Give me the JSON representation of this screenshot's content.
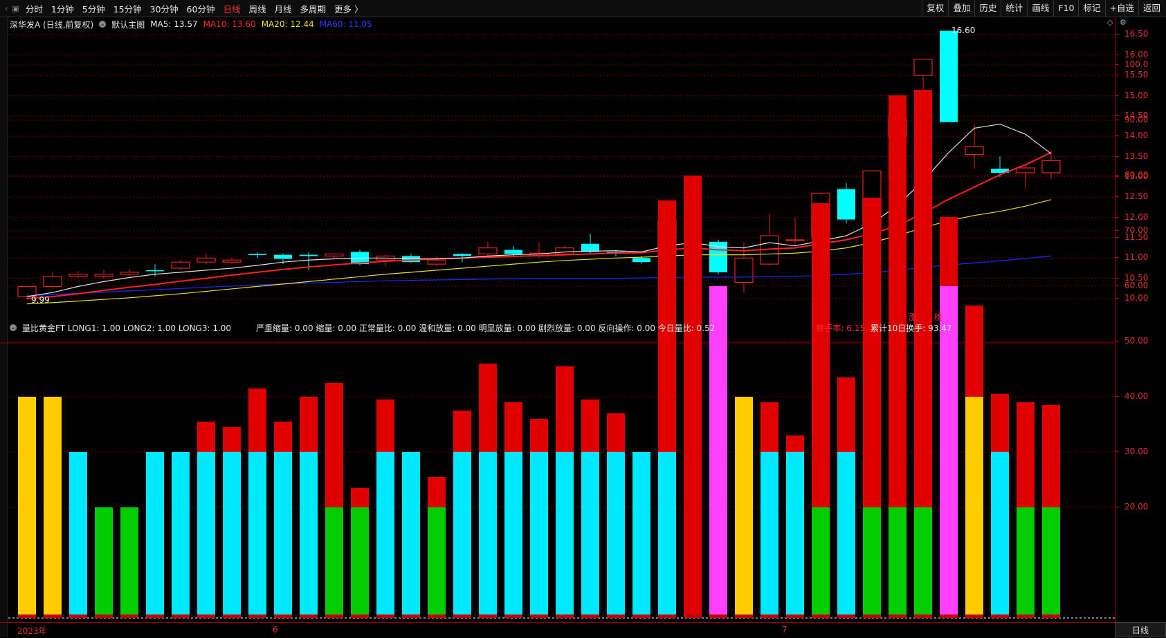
{
  "toolbar": {
    "periods": [
      "分时",
      "1分钟",
      "5分钟",
      "15分钟",
      "30分钟",
      "60分钟",
      "日线",
      "周线",
      "月线",
      "多周期",
      "更多 〉"
    ],
    "active_period": "日线",
    "right_buttons": [
      "复权",
      "叠加",
      "历史",
      "统计",
      "画线",
      "F10",
      "标记",
      "+自选",
      "返回"
    ]
  },
  "legend_main": {
    "stock": "深华发A (日线,前复权)",
    "template": "默认主图",
    "ma5": "MA5: 13.57",
    "ma10": "MA10: 13.60",
    "ma20": "MA20: 12.44",
    "ma60": "MA60: 11.05"
  },
  "legend_sub": {
    "indicator": "量比黄金FT  LONG1: 1.00  LONG2: 1.00  LONG3: 1.00",
    "params": "严重缩量: 0.00  缩量: 0.00  正常量比: 0.00  温和放量: 0.00  明显放量: 0.00  剧烈放量: 0.00  反向操作: 0.00  今日量比: 0.52",
    "turnover": "换手率: 6.15",
    "cum_turnover": "累计10日换手: 93.47"
  },
  "price_axis": [
    "16.50",
    "16.00",
    "15.50",
    "15.00",
    "14.50",
    "14.00",
    "13.50",
    "13.00",
    "12.50",
    "12.00",
    "11.50",
    "11.00",
    "10.50",
    "10.00"
  ],
  "vol_axis": [
    "100.0",
    "90.00",
    "80.00",
    "70.00",
    "60.00",
    "50.00",
    "40.00",
    "30.00",
    "20.00"
  ],
  "annotations": {
    "high": "16.60",
    "low": "9.99",
    "tag_zhang": "涨",
    "tag_bang": "榜"
  },
  "x_labels": [
    "2023年",
    "6",
    "7"
  ],
  "bottom_tab": "日线",
  "colors": {
    "up": "#e8221e",
    "down": "#00ffff",
    "ma5": "#e0e0e0",
    "ma10": "#ff2020",
    "ma20": "#e8e020",
    "ma60": "#1a2aff",
    "axis": "#e03030",
    "grid": "#7a0000"
  },
  "chart_data": [
    {
      "type": "candlestick",
      "title": "深华发A (日线,前复权)",
      "ylim": [
        9.8,
        16.8
      ],
      "candles": [
        {
          "o": 10.05,
          "c": 10.3,
          "h": 10.3,
          "l": 9.99
        },
        {
          "o": 10.3,
          "c": 10.55,
          "h": 10.65,
          "l": 10.25
        },
        {
          "o": 10.55,
          "c": 10.6,
          "h": 10.68,
          "l": 10.5
        },
        {
          "o": 10.55,
          "c": 10.6,
          "h": 10.7,
          "l": 10.5
        },
        {
          "o": 10.6,
          "c": 10.65,
          "h": 10.73,
          "l": 10.55
        },
        {
          "o": 10.7,
          "c": 10.68,
          "h": 10.85,
          "l": 10.55
        },
        {
          "o": 10.75,
          "c": 10.9,
          "h": 10.95,
          "l": 10.7
        },
        {
          "o": 10.9,
          "c": 11.0,
          "h": 11.1,
          "l": 10.85
        },
        {
          "o": 10.9,
          "c": 10.95,
          "h": 11.0,
          "l": 10.85
        },
        {
          "o": 11.1,
          "c": 11.08,
          "h": 11.15,
          "l": 11.0
        },
        {
          "o": 11.08,
          "c": 10.98,
          "h": 11.12,
          "l": 10.85
        },
        {
          "o": 11.08,
          "c": 11.05,
          "h": 11.15,
          "l": 10.7
        },
        {
          "o": 11.05,
          "c": 11.1,
          "h": 11.12,
          "l": 11.0
        },
        {
          "o": 11.15,
          "c": 10.85,
          "h": 11.2,
          "l": 10.82
        },
        {
          "o": 10.95,
          "c": 11.05,
          "h": 11.08,
          "l": 10.8
        },
        {
          "o": 11.05,
          "c": 10.9,
          "h": 11.1,
          "l": 10.88
        },
        {
          "o": 10.85,
          "c": 10.95,
          "h": 11.05,
          "l": 10.8
        },
        {
          "o": 11.1,
          "c": 11.05,
          "h": 11.12,
          "l": 10.9
        },
        {
          "o": 11.1,
          "c": 11.25,
          "h": 11.4,
          "l": 11.05
        },
        {
          "o": 11.2,
          "c": 11.1,
          "h": 11.3,
          "l": 11.05
        },
        {
          "o": 11.05,
          "c": 11.12,
          "h": 11.38,
          "l": 11.0
        },
        {
          "o": 11.1,
          "c": 11.25,
          "h": 11.3,
          "l": 11.05
        },
        {
          "o": 11.35,
          "c": 11.15,
          "h": 11.6,
          "l": 11.1
        },
        {
          "o": 11.15,
          "c": 11.12,
          "h": 11.18,
          "l": 11.05
        },
        {
          "o": 11.0,
          "c": 10.9,
          "h": 11.05,
          "l": 10.85
        },
        {
          "o": 11.05,
          "c": 11.95,
          "h": 11.95,
          "l": 11.0
        },
        {
          "o": 12.2,
          "c": 11.75,
          "h": 12.45,
          "l": 11.35
        },
        {
          "o": 11.4,
          "c": 10.65,
          "h": 11.45,
          "l": 10.6
        },
        {
          "o": 10.4,
          "c": 11.0,
          "h": 11.4,
          "l": 10.15
        },
        {
          "o": 10.85,
          "c": 11.55,
          "h": 12.1,
          "l": 10.82
        },
        {
          "o": 11.45,
          "c": 11.45,
          "h": 12.0,
          "l": 11.35
        },
        {
          "o": 11.5,
          "c": 12.6,
          "h": 12.6,
          "l": 11.45
        },
        {
          "o": 12.7,
          "c": 11.95,
          "h": 12.85,
          "l": 11.85
        },
        {
          "o": 11.75,
          "c": 13.15,
          "h": 13.15,
          "l": 11.75
        },
        {
          "o": 14.0,
          "c": 14.45,
          "h": 14.45,
          "l": 13.6
        },
        {
          "o": 15.5,
          "c": 15.9,
          "h": 15.9,
          "l": 14.95
        },
        {
          "o": 16.6,
          "c": 14.35,
          "h": 16.6,
          "l": 14.35
        },
        {
          "o": 13.55,
          "c": 13.75,
          "h": 14.3,
          "l": 13.2
        },
        {
          "o": 13.2,
          "c": 13.1,
          "h": 13.5,
          "l": 13.0
        },
        {
          "o": 13.1,
          "c": 13.22,
          "h": 13.3,
          "l": 12.7
        },
        {
          "o": 13.1,
          "c": 13.4,
          "h": 13.65,
          "l": 12.95
        }
      ],
      "ma5": [
        10.05,
        10.15,
        10.3,
        10.42,
        10.52,
        10.6,
        10.65,
        10.7,
        10.75,
        10.82,
        10.9,
        10.95,
        10.98,
        11.0,
        11.0,
        10.98,
        10.98,
        11.0,
        11.05,
        11.08,
        11.1,
        11.15,
        11.17,
        11.18,
        11.15,
        11.3,
        11.38,
        11.28,
        11.25,
        11.38,
        11.3,
        11.42,
        11.55,
        11.85,
        12.3,
        12.9,
        13.6,
        14.2,
        14.3,
        14.05,
        13.57
      ],
      "ma10": [
        10.0,
        10.05,
        10.12,
        10.2,
        10.28,
        10.35,
        10.43,
        10.5,
        10.58,
        10.65,
        10.72,
        10.78,
        10.83,
        10.88,
        10.92,
        10.95,
        10.98,
        11.0,
        11.02,
        11.04,
        11.06,
        11.08,
        11.1,
        11.12,
        11.13,
        11.2,
        11.25,
        11.2,
        11.18,
        11.22,
        11.25,
        11.35,
        11.45,
        11.6,
        11.8,
        12.1,
        12.45,
        12.75,
        13.05,
        13.3,
        13.6
      ],
      "ma20": [
        9.87,
        9.9,
        9.94,
        9.98,
        10.02,
        10.07,
        10.12,
        10.18,
        10.24,
        10.3,
        10.36,
        10.42,
        10.48,
        10.54,
        10.6,
        10.65,
        10.7,
        10.75,
        10.8,
        10.85,
        10.9,
        10.94,
        10.97,
        11.0,
        11.02,
        11.05,
        11.08,
        11.08,
        11.08,
        11.1,
        11.12,
        11.17,
        11.25,
        11.38,
        11.55,
        11.75,
        11.92,
        12.05,
        12.15,
        12.28,
        12.44
      ],
      "ma60": [
        10.07,
        10.1,
        10.13,
        10.16,
        10.19,
        10.22,
        10.25,
        10.28,
        10.31,
        10.34,
        10.36,
        10.38,
        10.4,
        10.42,
        10.44,
        10.45,
        10.46,
        10.47,
        10.48,
        10.49,
        10.5,
        10.5,
        10.5,
        10.5,
        10.51,
        10.52,
        10.53,
        10.53,
        10.53,
        10.54,
        10.55,
        10.57,
        10.6,
        10.64,
        10.7,
        10.77,
        10.83,
        10.88,
        10.93,
        10.99,
        11.05
      ]
    },
    {
      "type": "bar",
      "title": "量比黄金FT",
      "ylim": [
        0,
        105
      ],
      "bars": [
        {
          "v": 40,
          "c": "yellow"
        },
        {
          "v": 40,
          "c": "yellow"
        },
        {
          "v": 30,
          "c": "cyan"
        },
        {
          "v": 20,
          "c": "green"
        },
        {
          "v": 20,
          "c": "green"
        },
        {
          "v": 30,
          "c": "cyan"
        },
        {
          "v": 30,
          "c": "cyan"
        },
        {
          "v": 35.5,
          "c": "cyan"
        },
        {
          "v": 34.5,
          "c": "cyan"
        },
        {
          "v": 41.5,
          "c": "cyan"
        },
        {
          "v": 35.5,
          "c": "cyan"
        },
        {
          "v": 40,
          "c": "cyan"
        },
        {
          "v": 42.5,
          "c": "green"
        },
        {
          "v": 23.5,
          "c": "green"
        },
        {
          "v": 39.5,
          "c": "cyan"
        },
        {
          "v": 30,
          "c": "cyan"
        },
        {
          "v": 25.5,
          "c": "green"
        },
        {
          "v": 37.5,
          "c": "cyan"
        },
        {
          "v": 46,
          "c": "cyan"
        },
        {
          "v": 39,
          "c": "cyan"
        },
        {
          "v": 36,
          "c": "cyan"
        },
        {
          "v": 45.5,
          "c": "cyan"
        },
        {
          "v": 39.5,
          "c": "cyan"
        },
        {
          "v": 37,
          "c": "cyan"
        },
        {
          "v": 30,
          "c": "cyan"
        },
        {
          "v": 75.5,
          "c": "cyan"
        },
        {
          "v": 80,
          "c": "red"
        },
        {
          "v": 60,
          "c": "magenta"
        },
        {
          "v": 40,
          "c": "yellow"
        },
        {
          "v": 39,
          "c": "cyan"
        },
        {
          "v": 33,
          "c": "cyan"
        },
        {
          "v": 75,
          "c": "green"
        },
        {
          "v": 43.5,
          "c": "cyan"
        },
        {
          "v": 76,
          "c": "green"
        },
        {
          "v": 94.5,
          "c": "green"
        },
        {
          "v": 95.5,
          "c": "green"
        },
        {
          "v": 72.5,
          "c": "magenta"
        },
        {
          "v": 56.5,
          "c": "yellow"
        },
        {
          "v": 40.5,
          "c": "cyan"
        },
        {
          "v": 39,
          "c": "green"
        },
        {
          "v": 38.5,
          "c": "green"
        }
      ]
    }
  ]
}
